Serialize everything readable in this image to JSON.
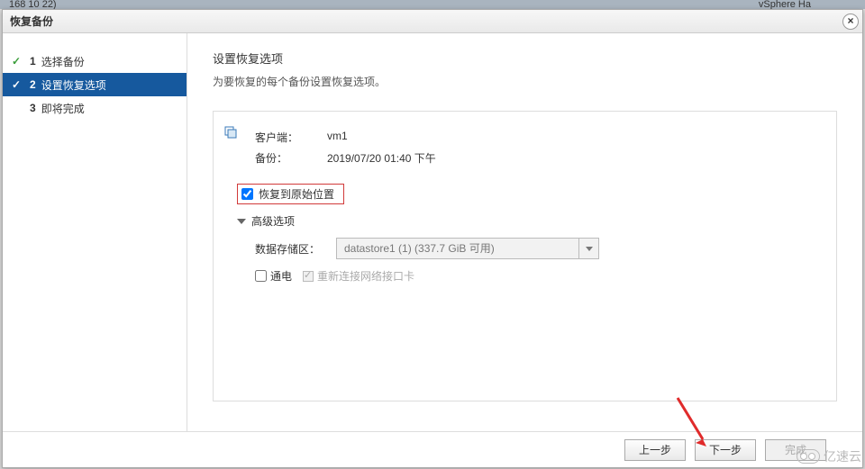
{
  "bg": {
    "left": "168 10 22)",
    "right": "vSphere Ha"
  },
  "dialog": {
    "title": "恢复备份",
    "close_symbol": "×"
  },
  "steps": [
    {
      "num": "1",
      "label": "选择备份",
      "state": "done"
    },
    {
      "num": "2",
      "label": "设置恢复选项",
      "state": "active"
    },
    {
      "num": "3",
      "label": "即将完成",
      "state": "pending"
    }
  ],
  "main": {
    "heading": "设置恢复选项",
    "subheading": "为要恢复的每个备份设置恢复选项。",
    "client_label": "客户端：",
    "client_value": "vm1",
    "backup_label": "备份：",
    "backup_value": "2019/07/20 01:40 下午",
    "restore_orig_label": "恢复到原始位置",
    "advanced_label": "高级选项",
    "datastore_label": "数据存储区：",
    "datastore_value": "datastore1 (1) (337.7 GiB 可用)",
    "power_label": "通电",
    "reconnect_label": "重新连接网络接口卡"
  },
  "footer": {
    "prev": "上一步",
    "next": "下一步",
    "finish": "完成"
  },
  "watermark": "亿速云"
}
